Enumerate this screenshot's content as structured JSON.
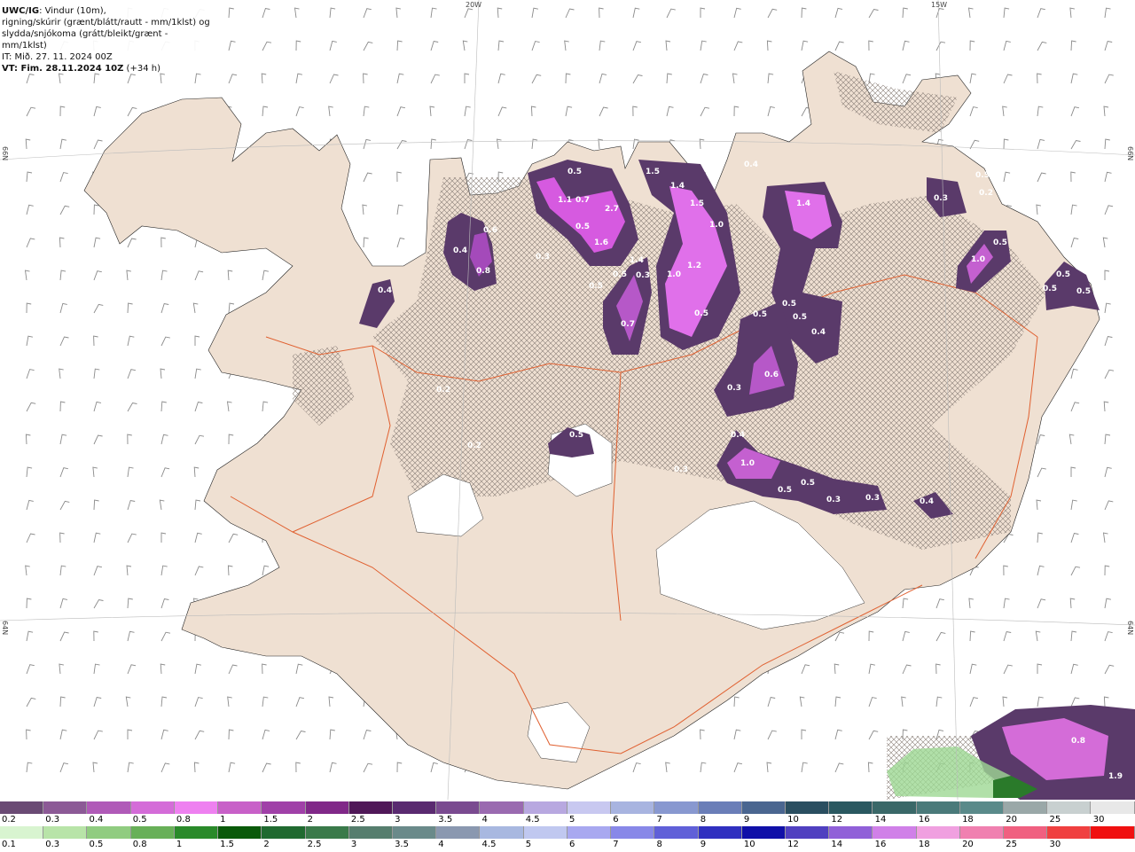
{
  "info": {
    "model": "UWC/IG",
    "line1_rest": ": Vindur (10m),",
    "line2": "rigning/skúrir (grænt/blátt/rautt - mm/1klst) og",
    "line3": "slydda/snjókoma (grátt/bleikt/grænt - mm/1klst)",
    "line4": "IT: Mið. 27. 11. 2024 00Z",
    "vt_bold": "VT: Fim. 28.11.2024 10Z",
    "vt_rest": " (+34 h)"
  },
  "grid_labels": {
    "top_20w": "20W",
    "top_15w": "15W",
    "left_66n": "66N",
    "right_66n": "66N",
    "left_64n": "64N",
    "right_64n": "64N"
  },
  "precip_labels": [
    "0.5",
    "1.1",
    "0.7",
    "0.5",
    "2.7",
    "1.6",
    "0.5",
    "0.3",
    "1.4",
    "1.4",
    "1.5",
    "1.0",
    "1.2",
    "1.5",
    "1.0",
    "0.5",
    "0.7",
    "0.4",
    "0.8",
    "0.6",
    "0.4",
    "0.5",
    "0.3",
    "0.4",
    "1.4",
    "0.5",
    "0.5",
    "0.4",
    "0.6",
    "0.3",
    "0.5",
    "0.2",
    "0.3",
    "0.2",
    "0.5",
    "0.4",
    "1.0",
    "0.5",
    "0.5",
    "0.3",
    "0.3",
    "0.4",
    "0.3",
    "0.5",
    "0.2",
    "0.5",
    "1.0",
    "0.5",
    "0.5",
    "0.5",
    "0.8",
    "1.9"
  ],
  "legend": {
    "snow_colors": [
      "#6a4a74",
      "#8c5a96",
      "#b05ab8",
      "#d46cd8",
      "#ee80f0",
      "#c860c8",
      "#a040a8",
      "#802888",
      "#501858",
      "#5a2a70",
      "#7a4a90",
      "#9a6ab0",
      "#b8a8e0",
      "#c8c8f0",
      "#a8b4e0",
      "#8898d0",
      "#6a7eb8",
      "#4a6690",
      "#2a4e60",
      "#2a5860",
      "#3a6868",
      "#4a7a7a",
      "#5a8a8a",
      "#9aa8a8",
      "#c8d0d0",
      "#e8e8e8"
    ],
    "snow_labels": [
      "0.2",
      "0.3",
      "0.4",
      "0.5",
      "0.8",
      "1",
      "1.5",
      "2",
      "2.5",
      "3",
      "3.5",
      "4",
      "4.5",
      "5",
      "6",
      "7",
      "8",
      "9",
      "10",
      "12",
      "14",
      "16",
      "18",
      "20",
      "25",
      "30"
    ],
    "rain_colors": [
      "#d8f4d0",
      "#b8e4a8",
      "#90cc80",
      "#68b058",
      "#2a8a2a",
      "#0a5a0a",
      "#206a30",
      "#3a7a4a",
      "#567e6e",
      "#6a8a8a",
      "#8a98b0",
      "#a8b8e0",
      "#c0c8f0",
      "#a8a8f0",
      "#8888e8",
      "#6060d8",
      "#3030c0",
      "#1010a8",
      "#5040c0",
      "#9060d8",
      "#d080e8",
      "#f0a0e0",
      "#f080b0",
      "#f06080",
      "#f04040",
      "#f01010"
    ],
    "rain_labels": [
      "0.1",
      "0.3",
      "0.5",
      "0.8",
      "1",
      "1.5",
      "2",
      "2.5",
      "3",
      "3.5",
      "4",
      "4.5",
      "5",
      "6",
      "7",
      "8",
      "9",
      "10",
      "12",
      "14",
      "16",
      "18",
      "20",
      "25",
      "30"
    ]
  }
}
